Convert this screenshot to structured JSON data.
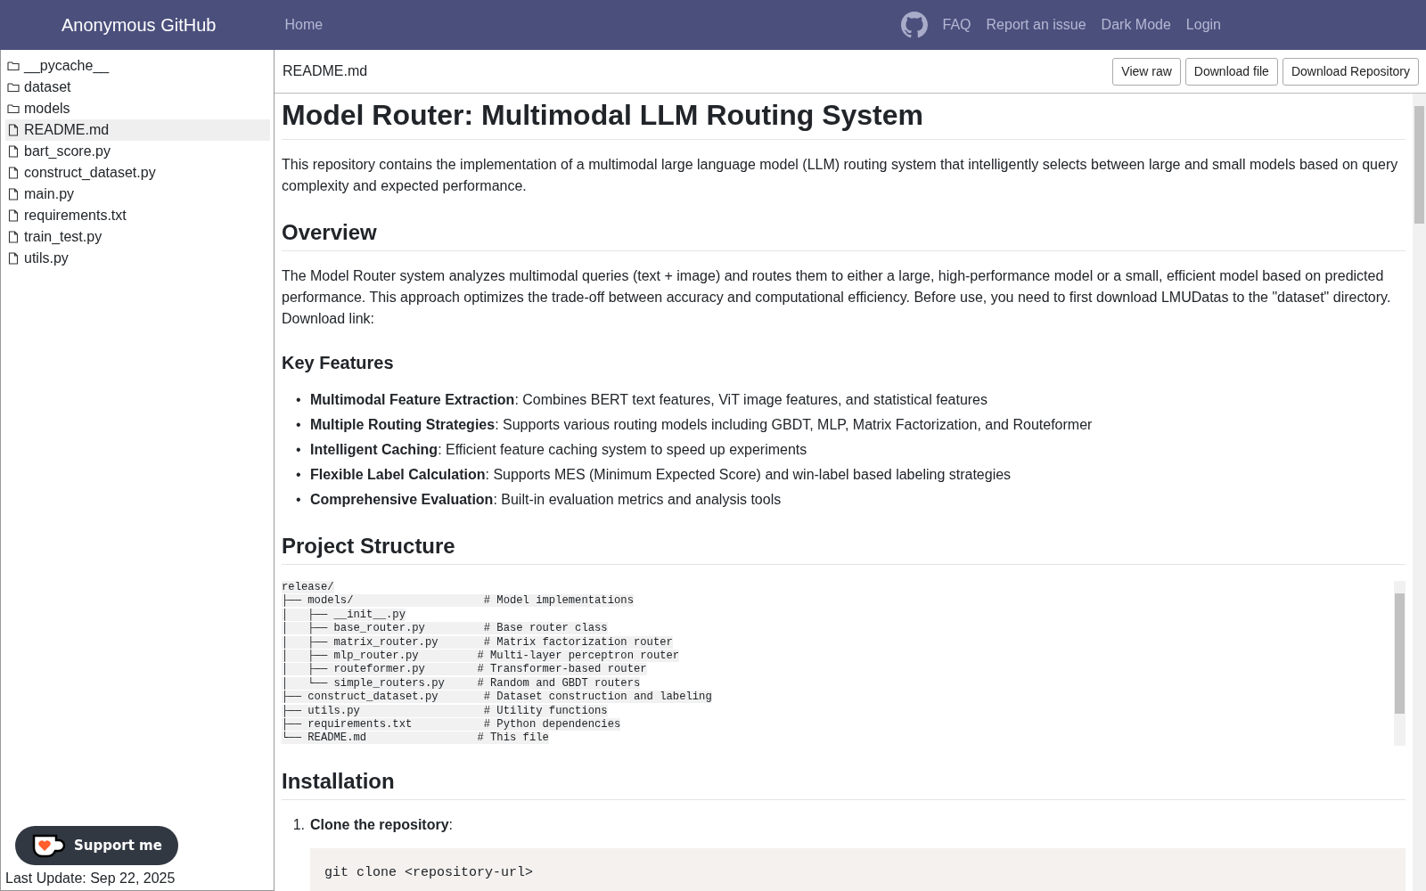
{
  "navbar": {
    "brand": "Anonymous GitHub",
    "left_links": [
      "Home"
    ],
    "right_links": [
      "FAQ",
      "Report an issue",
      "Dark Mode",
      "Login"
    ]
  },
  "sidebar": {
    "items": [
      {
        "kind": "folder",
        "label": "__pycache__",
        "selected": false
      },
      {
        "kind": "folder",
        "label": "dataset",
        "selected": false
      },
      {
        "kind": "folder",
        "label": "models",
        "selected": false
      },
      {
        "kind": "file",
        "label": "README.md",
        "selected": true
      },
      {
        "kind": "file",
        "label": "bart_score.py",
        "selected": false
      },
      {
        "kind": "file",
        "label": "construct_dataset.py",
        "selected": false
      },
      {
        "kind": "file",
        "label": "main.py",
        "selected": false
      },
      {
        "kind": "file",
        "label": "requirements.txt",
        "selected": false
      },
      {
        "kind": "file",
        "label": "train_test.py",
        "selected": false
      },
      {
        "kind": "file",
        "label": "utils.py",
        "selected": false
      }
    ],
    "support_button": "Support me",
    "last_update": "Last Update: Sep 22, 2025"
  },
  "file_header": {
    "filename": "README.md",
    "buttons": [
      "View raw",
      "Download file",
      "Download Repository"
    ]
  },
  "readme": [
    {
      "kind": "h1",
      "text": "Model Router: Multimodal LLM Routing System"
    },
    {
      "kind": "p",
      "text": "This repository contains the implementation of a multimodal large language model (LLM) routing system that intelligently selects between large and small models based on query complexity and expected performance."
    },
    {
      "kind": "h2",
      "text": "Overview"
    },
    {
      "kind": "p",
      "text": "The Model Router system analyzes multimodal queries (text + image) and routes them to either a large, high-performance model or a small, efficient model based on predicted performance. This approach optimizes the trade-off between accuracy and computational efficiency. Before use, you need to first download LMUDatas to the \"dataset\" directory. Download link:"
    },
    {
      "kind": "h3",
      "text": "Key Features"
    },
    {
      "kind": "ul",
      "items": [
        {
          "marker": "•",
          "text": "**Multimodal Feature Extraction**: Combines BERT text features, ViT image features, and statistical features"
        },
        {
          "marker": "•",
          "text": "**Multiple Routing Strategies**: Supports various routing models including GBDT, MLP, Matrix Factorization, and Routeformer"
        },
        {
          "marker": "•",
          "text": "**Intelligent Caching**: Efficient feature caching system to speed up experiments"
        },
        {
          "marker": "•",
          "text": "**Flexible Label Calculation**: Supports MES (Minimum Expected Score) and win-label based labeling strategies"
        },
        {
          "marker": "•",
          "text": "**Comprehensive Evaluation**: Built-in evaluation metrics and analysis tools"
        }
      ]
    },
    {
      "kind": "h2",
      "text": "Project Structure"
    },
    {
      "kind": "tree",
      "lines": [
        "release/",
        "├── models/                    # Model implementations",
        "│   ├── __init__.py",
        "│   ├── base_router.py         # Base router class",
        "│   ├── matrix_router.py       # Matrix factorization router",
        "│   ├── mlp_router.py         # Multi-layer perceptron router",
        "│   ├── routeformer.py        # Transformer-based router",
        "│   └── simple_routers.py     # Random and GBDT routers",
        "├── construct_dataset.py       # Dataset construction and labeling",
        "├── utils.py                   # Utility functions",
        "├── requirements.txt           # Python dependencies",
        "└── README.md                 # This file"
      ]
    },
    {
      "kind": "h2",
      "text": "Installation"
    },
    {
      "kind": "ol",
      "items": [
        {
          "marker": "1.",
          "text": "**Clone the repository**:",
          "code": "git clone <repository-url>"
        }
      ]
    }
  ]
}
